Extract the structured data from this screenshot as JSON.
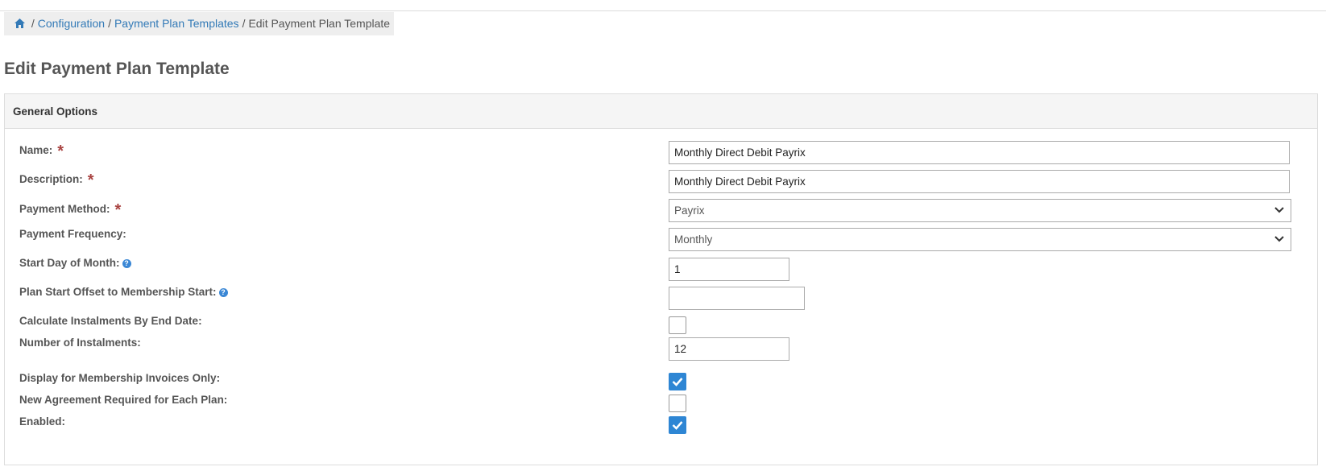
{
  "breadcrumb": {
    "home_icon": "home-icon",
    "separator": "/",
    "items": [
      "Configuration",
      "Payment Plan Templates",
      "Edit Payment Plan Template"
    ]
  },
  "page": {
    "title": "Edit Payment Plan Template"
  },
  "panel": {
    "heading": "General Options"
  },
  "required_marker": "*",
  "colors": {
    "link": "#337ab7",
    "required": "#a94442",
    "checkbox_checked": "#2e86d4",
    "help_icon": "#3a87d5"
  },
  "form": {
    "name": {
      "label": "Name:",
      "value": "Monthly Direct Debit Payrix"
    },
    "description": {
      "label": "Description:",
      "value": "Monthly Direct Debit Payrix"
    },
    "payment_method": {
      "label": "Payment Method:",
      "value": "Payrix"
    },
    "payment_frequency": {
      "label": "Payment Frequency:",
      "value": "Monthly"
    },
    "start_day": {
      "label": "Start Day of Month:",
      "value": "1"
    },
    "plan_start_offset": {
      "label": "Plan Start Offset to Membership Start:",
      "value": ""
    },
    "calc_by_end_date": {
      "label": "Calculate Instalments By End Date:",
      "checked": false
    },
    "num_instalments": {
      "label": "Number of Instalments:",
      "value": "12"
    },
    "membership_invoices_only": {
      "label": "Display for Membership Invoices Only:",
      "checked": true
    },
    "new_agreement": {
      "label": "New Agreement Required for Each Plan:",
      "checked": false
    },
    "enabled": {
      "label": "Enabled:",
      "checked": true
    }
  }
}
